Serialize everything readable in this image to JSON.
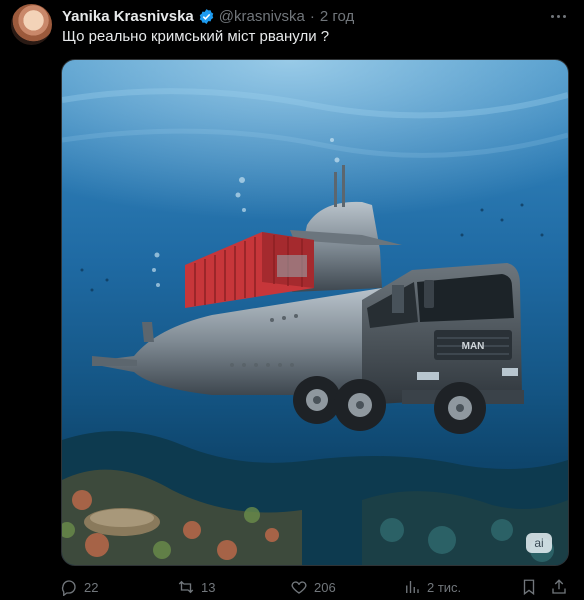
{
  "author": {
    "name": "Yanika Krasnivska",
    "handle": "@krasnivska",
    "time": "2 год",
    "verified": true
  },
  "post": {
    "text": "Що реально кримський міст рванули ?"
  },
  "media": {
    "ai_badge": "ai",
    "truck_brand": "MAN"
  },
  "actions": {
    "replies": "22",
    "reposts": "13",
    "likes": "206",
    "views": "2 тис."
  },
  "colors": {
    "background": "#000000",
    "text": "#e7e9ea",
    "muted": "#71767b",
    "verified": "#1d9bf0"
  }
}
